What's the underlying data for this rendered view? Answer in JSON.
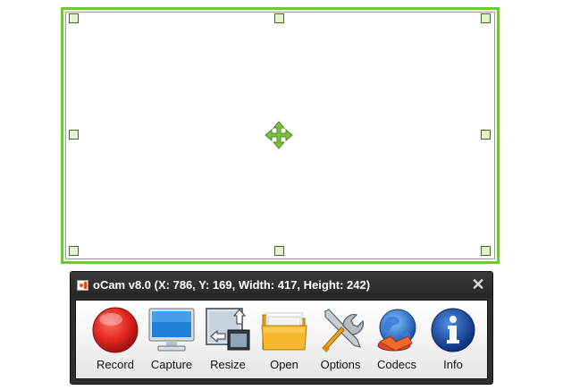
{
  "window": {
    "title": "oCam v8.0 (X: 786, Y: 169, Width: 417, Height: 242)",
    "close_glyph": "✕"
  },
  "toolbar": {
    "buttons": [
      {
        "label": "Record",
        "icon": "record-icon"
      },
      {
        "label": "Capture",
        "icon": "monitor-icon"
      },
      {
        "label": "Resize",
        "icon": "resize-icon"
      },
      {
        "label": "Open",
        "icon": "folder-icon"
      },
      {
        "label": "Options",
        "icon": "tools-icon"
      },
      {
        "label": "Codecs",
        "icon": "globe-icon"
      },
      {
        "label": "Info",
        "icon": "info-icon"
      }
    ]
  },
  "colors": {
    "region_border": "#7ac142",
    "handle_fill": "#e3f2cf",
    "record_red": "#e2261f",
    "window_dark": "#2f2f2f"
  }
}
